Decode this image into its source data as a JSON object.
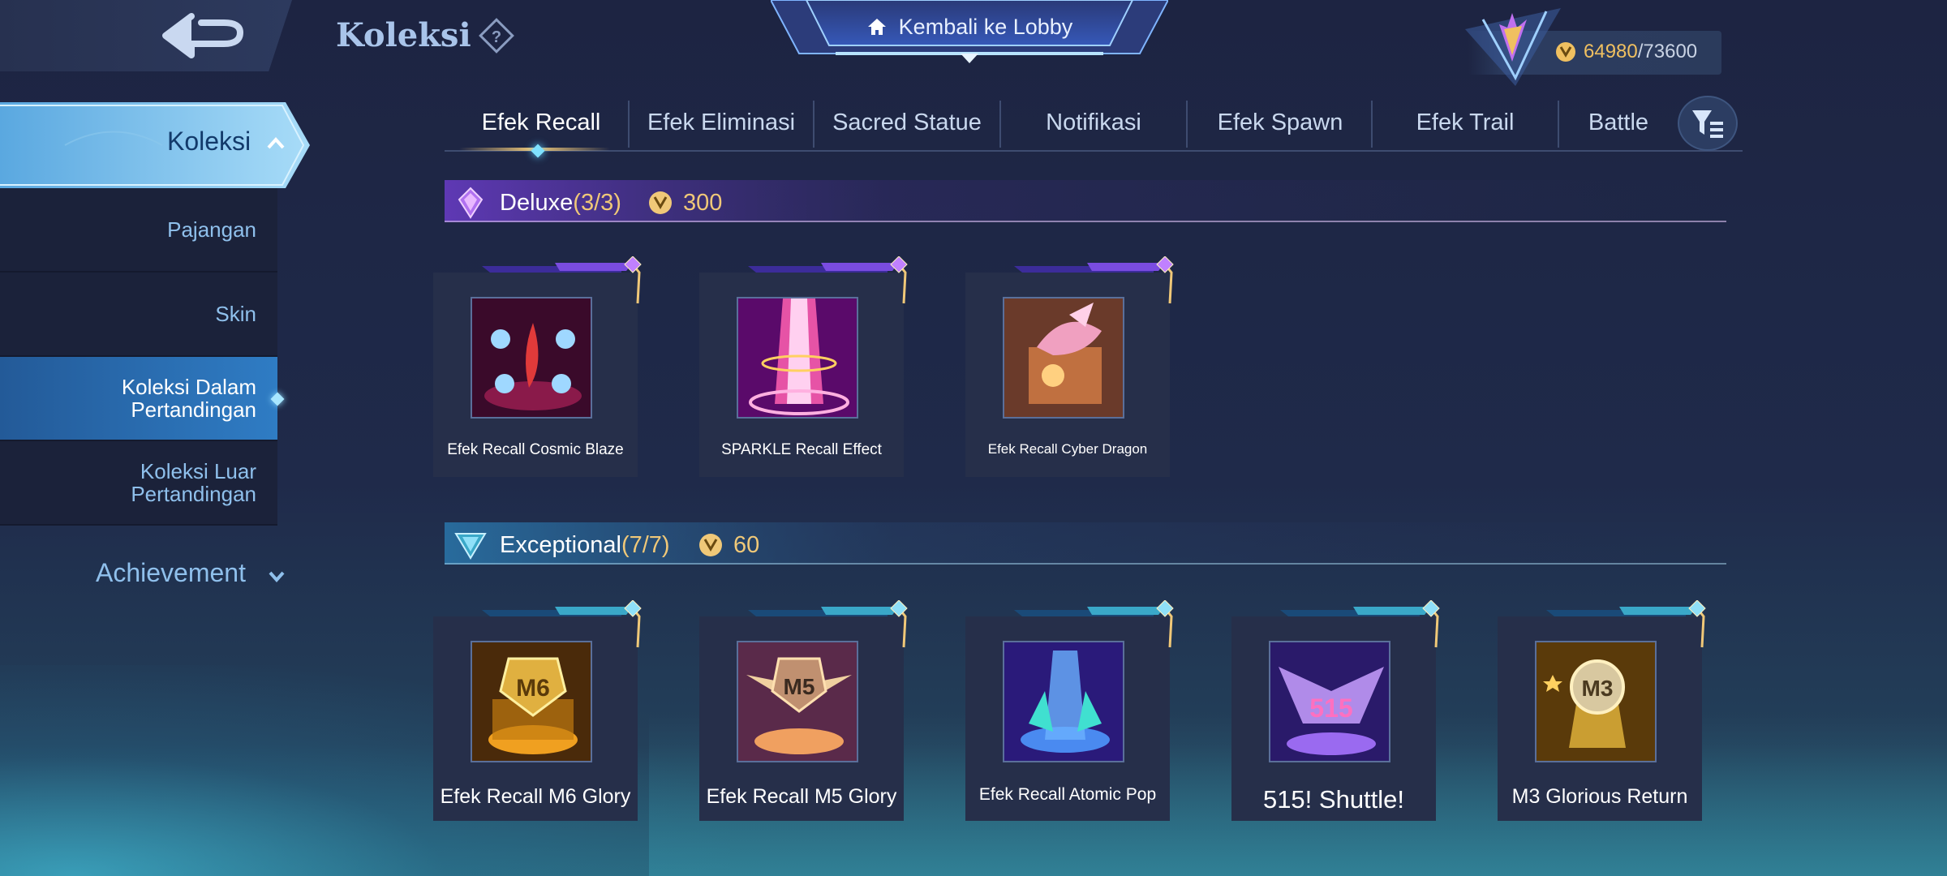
{
  "header": {
    "title": "Koleksi",
    "lobby_label": "Kembali ke Lobby",
    "currency_current": "64980",
    "currency_max": "/73600"
  },
  "sidebar": {
    "active_label": "Koleksi",
    "items": [
      {
        "label": "Pajangan"
      },
      {
        "label": "Skin"
      },
      {
        "label": "Koleksi Dalam\nPertandingan"
      },
      {
        "label": "Koleksi Luar\nPertandingan"
      }
    ],
    "achievement_label": "Achievement"
  },
  "tabs": [
    {
      "label": "Efek Recall"
    },
    {
      "label": "Efek Eliminasi"
    },
    {
      "label": "Sacred Statue"
    },
    {
      "label": "Notifikasi"
    },
    {
      "label": "Efek Spawn"
    },
    {
      "label": "Efek Trail"
    },
    {
      "label": "Battle"
    }
  ],
  "sections": [
    {
      "title": "Deluxe",
      "count": "(3/3)",
      "price": "300",
      "items": [
        {
          "name": "Efek Recall Cosmic Blaze"
        },
        {
          "name": "SPARKLE Recall Effect"
        },
        {
          "name": "Efek Recall Cyber Dragon"
        }
      ]
    },
    {
      "title": "Exceptional",
      "count": "(7/7)",
      "price": "60",
      "items": [
        {
          "name": "Efek Recall M6 Glory"
        },
        {
          "name": "Efek Recall M5 Glory"
        },
        {
          "name": "Efek Recall Atomic Pop"
        },
        {
          "name": "515! Shuttle!"
        },
        {
          "name": "M3 Glorious Return"
        }
      ]
    }
  ],
  "colors": {
    "accent_gold": "#f0c878",
    "deluxe_purple": "#7a3cc8",
    "exceptional_teal": "#3aa8c8",
    "sidebar_selected": "#2f7cc4"
  },
  "icons": {
    "back": "back-arrow-icon",
    "help": "help-icon",
    "home": "home-icon",
    "coin": "coin-icon",
    "filter": "filter-icon"
  }
}
